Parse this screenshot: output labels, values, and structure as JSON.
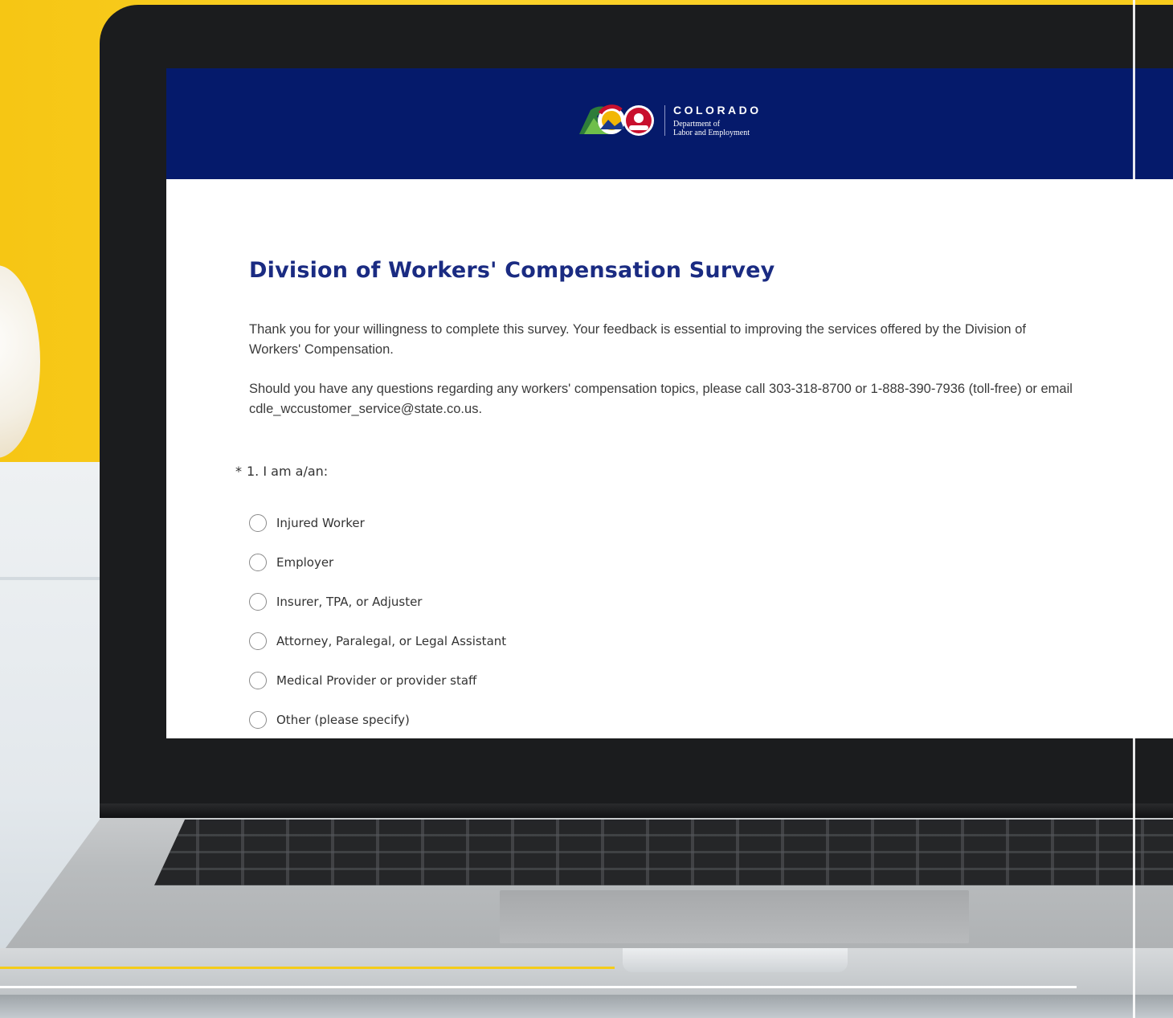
{
  "header": {
    "logo_title": "COLORADO",
    "logo_sub_line1": "Department of",
    "logo_sub_line2": "Labor and Employment",
    "logo_badge": "CDLE",
    "background_color": "#051a6b"
  },
  "survey": {
    "title": "Division of Workers' Compensation Survey",
    "intro_paragraph_1": "Thank you for your willingness to complete this survey. Your feedback is essential to improving the services offered by the Division of Workers' Compensation.",
    "intro_paragraph_2": "Should you have any questions regarding any workers' compensation topics, please call 303-318-8700 or 1-888-390-7936 (toll-free) or email cdle_wccustomer_service@state.co.us.",
    "title_color": "#1a2b82"
  },
  "question_1": {
    "required_marker": "*",
    "label": "1. I am a/an:",
    "options": [
      "Injured Worker",
      "Employer",
      "Insurer, TPA, or Adjuster",
      "Attorney, Paralegal, or Legal Assistant",
      "Medical Provider or provider staff",
      "Other (please specify)"
    ]
  },
  "icons": {
    "colorado_logo": "colorado-c-mountain-icon",
    "cdle_seal": "cdle-seal-icon",
    "radio": "radio-unselected-icon"
  }
}
